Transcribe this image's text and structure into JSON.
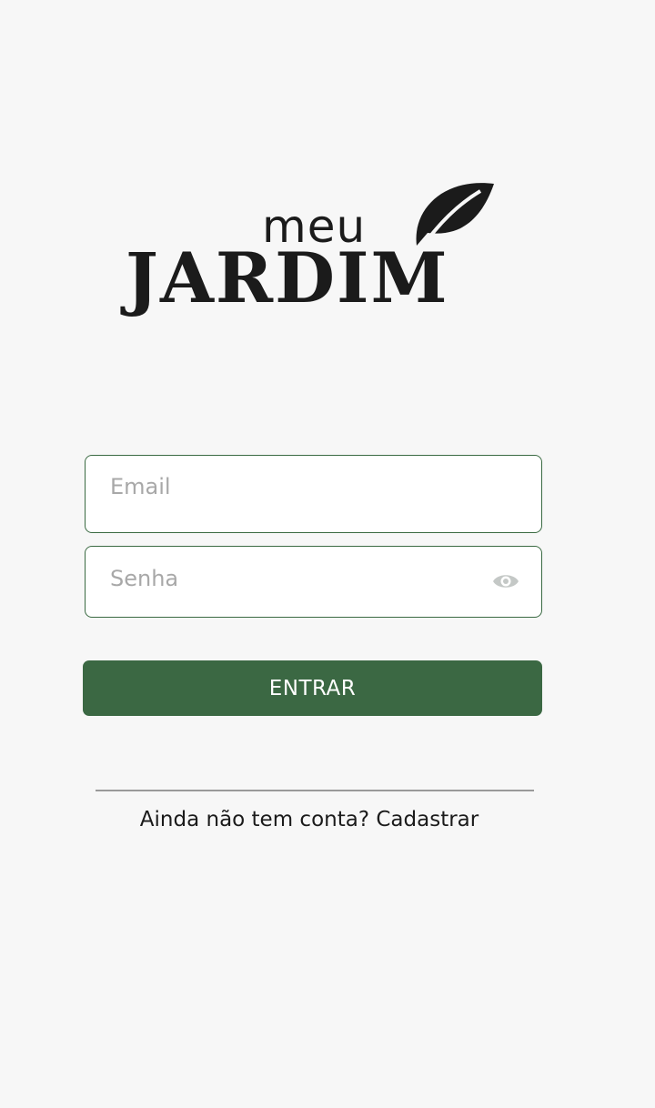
{
  "logo": {
    "line1": "meu",
    "line2": "JARDIM"
  },
  "form": {
    "email_placeholder": "Email",
    "password_placeholder": "Senha",
    "submit_label": "ENTRAR"
  },
  "footer": {
    "prompt": "Ainda não tem conta?",
    "link_label": "Cadastrar"
  },
  "colors": {
    "primary": "#3b6843",
    "background": "#f7f7f7",
    "field_border": "#3a6a42"
  }
}
